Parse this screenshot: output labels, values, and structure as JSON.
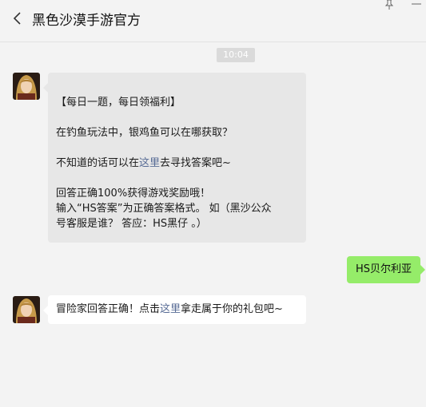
{
  "header": {
    "title": "黑色沙漠手游官方"
  },
  "chat": {
    "timestamp": "10:04",
    "messages": [
      {
        "lines": [
          "【每日一题，每日领福利】",
          "在钓鱼玩法中，银鸡鱼可以在哪获取？",
          "不知道的话可以在",
          "这里",
          "去寻找答案吧~",
          "回答正确100%获得游戏奖励哦！",
          "输入“HS答案”为正确答案格式。 如（黑沙公众",
          "号客服是谁？ 答应：HS黑仔 。）"
        ]
      },
      {
        "text": "HS贝尔利亚"
      },
      {
        "prefix": "冒险家回答正确！点击",
        "link": "这里",
        "suffix": "拿走属于你的礼包吧~"
      }
    ]
  },
  "colors": {
    "background": "#f3f3f3",
    "incoming_bubble": "#e7e7e7",
    "outgoing_bubble": "#95ec69",
    "link": "#576b95"
  },
  "icons": [
    "back-arrow-icon",
    "pin-icon",
    "minimize-icon"
  ]
}
